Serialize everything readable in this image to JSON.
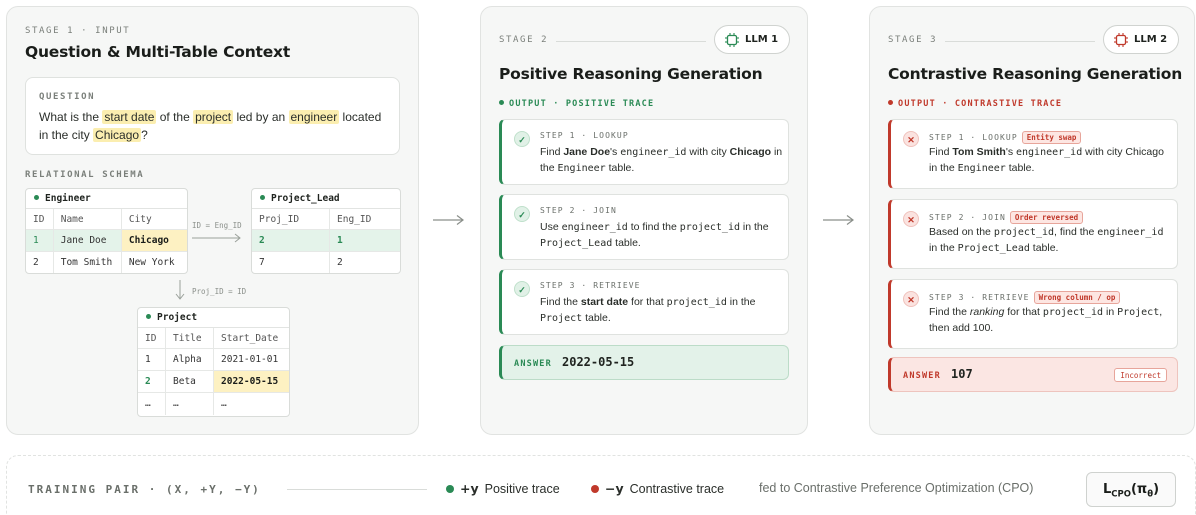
{
  "stage1": {
    "kicker": "STAGE 1 · INPUT",
    "title": "Question & Multi-Table Context",
    "question_label": "QUESTION",
    "question": {
      "t1": "What is the ",
      "h1": "start date",
      "t2": " of the ",
      "h2": "project",
      "t3": " led by an ",
      "h3": "engineer",
      "t4": " located in the city ",
      "h4": "Chicago",
      "t5": "?"
    },
    "schema_label": "RELATIONAL SCHEMA",
    "engineer": {
      "name": "Engineer",
      "headers": [
        "ID",
        "Name",
        "City"
      ],
      "rows": [
        [
          "1",
          "Jane Doe",
          "Chicago"
        ],
        [
          "2",
          "Tom Smith",
          "New York"
        ]
      ]
    },
    "project_lead": {
      "name": "Project_Lead",
      "headers": [
        "Proj_ID",
        "Eng_ID"
      ],
      "rows": [
        [
          "2",
          "1"
        ],
        [
          "7",
          "2"
        ]
      ]
    },
    "project": {
      "name": "Project",
      "headers": [
        "ID",
        "Title",
        "Start_Date"
      ],
      "rows": [
        [
          "1",
          "Alpha",
          "2021-01-01"
        ],
        [
          "2",
          "Beta",
          "2022-05-15"
        ],
        [
          "…",
          "…",
          "…"
        ]
      ]
    },
    "join1_label": "ID = Eng_ID",
    "join2_label": "Proj_ID = ID"
  },
  "stage2": {
    "kicker": "STAGE 2",
    "llm": "LLM 1",
    "title": "Positive Reasoning Generation",
    "output_label": "OUTPUT · POSITIVE TRACE",
    "steps": [
      {
        "label": "STEP 1 · LOOKUP",
        "a": "Find ",
        "b": "Jane Doe",
        "c": "'s ",
        "d": "engineer_id",
        "e": " with city ",
        "f": "Chicago",
        "g": " in the ",
        "h": "Engineer",
        "i": " table."
      },
      {
        "label": "STEP 2 · JOIN",
        "a": "Use ",
        "b": "engineer_id",
        "c": " to find the ",
        "d": "project_id",
        "e": " in the ",
        "f": "Project_Lead",
        "g": " table."
      },
      {
        "label": "STEP 3 · RETRIEVE",
        "a": "Find the ",
        "b": "start date",
        "c": " for that ",
        "d": "project_id",
        "e": " in the ",
        "f": "Project",
        "g": " table."
      }
    ],
    "answer_label": "ANSWER",
    "answer": "2022-05-15"
  },
  "stage3": {
    "kicker": "STAGE 3",
    "llm": "LLM 2",
    "title": "Contrastive Reasoning Generation",
    "output_label": "OUTPUT · CONTRASTIVE TRACE",
    "steps": [
      {
        "label": "STEP 1 · LOOKUP",
        "tag": "Entity swap",
        "a": "Find ",
        "b": "Tom Smith",
        "c": "'s ",
        "d": "engineer_id",
        "e": " with city Chicago in the ",
        "f": "Engineer",
        "g": " table."
      },
      {
        "label": "STEP 2 · JOIN",
        "tag": "Order reversed",
        "a": "Based on the ",
        "b": "project_id",
        "c": ", find the ",
        "d": "engineer_id",
        "e": " in the ",
        "f": "Project_Lead",
        "g": " table."
      },
      {
        "label": "STEP 3 · RETRIEVE",
        "tag": "Wrong column / op",
        "a": "Find the ",
        "b": "ranking",
        "c": " for that ",
        "d": "project_id",
        "e": " in ",
        "f": "Project",
        "g": ", then add 100."
      }
    ],
    "answer_label": "ANSWER",
    "answer": "107",
    "badge": "Incorrect"
  },
  "bottom": {
    "training_pair": "TRAINING PAIR · (X, +Y, −Y)",
    "pos_sym": "+y",
    "pos_label": "Positive trace",
    "neg_sym": "−y",
    "neg_label": "Contrastive trace",
    "fed": "fed to Contrastive Preference Optimization (CPO)",
    "loss_main": "L",
    "loss_sub": "CPO",
    "loss_arg": "(π",
    "loss_theta": "θ",
    "loss_close": ")"
  },
  "colors": {
    "positive": "#2a8a55",
    "negative": "#c0392b",
    "highlight": "#fbeeb0"
  },
  "icons": [
    "check-icon",
    "cross-icon",
    "chip-icon",
    "arrow-right-icon",
    "arrow-down-icon"
  ]
}
